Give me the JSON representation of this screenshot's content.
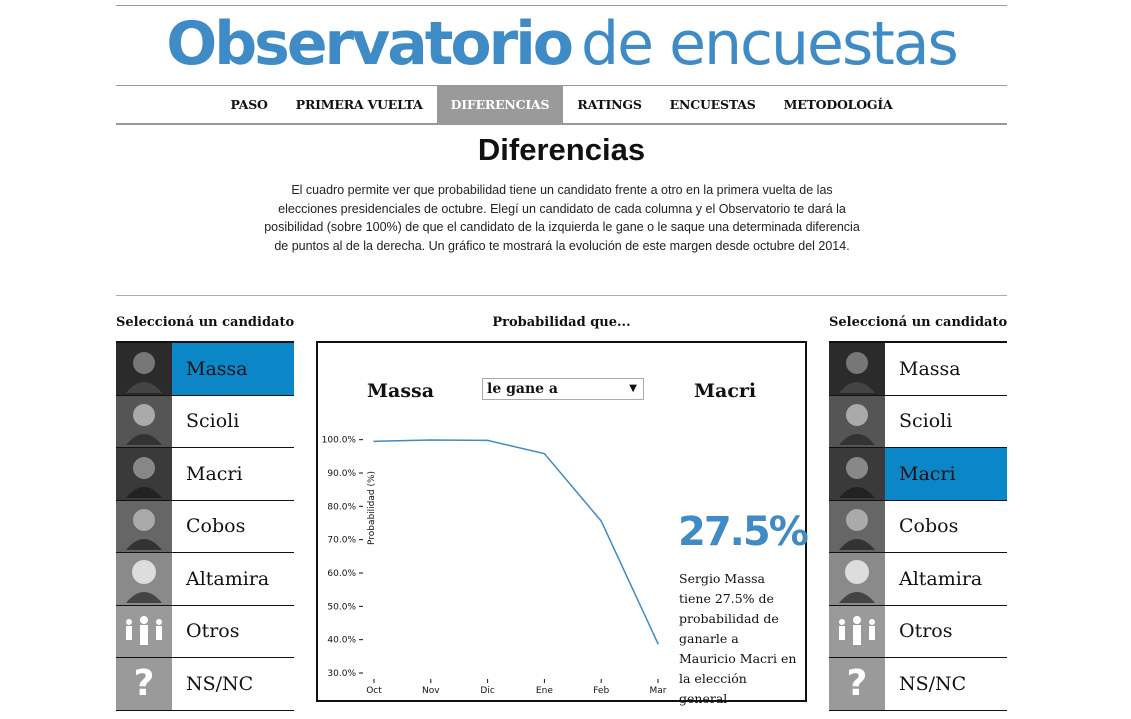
{
  "site": {
    "title_bold": "Observatorio",
    "title_light": "de encuestas"
  },
  "nav": [
    {
      "label": "PASO",
      "active": false
    },
    {
      "label": "PRIMERA VUELTA",
      "active": false
    },
    {
      "label": "DIFERENCIAS",
      "active": true
    },
    {
      "label": "RATINGS",
      "active": false
    },
    {
      "label": "ENCUESTAS",
      "active": false
    },
    {
      "label": "METODOLOGÍA",
      "active": false
    }
  ],
  "page": {
    "title": "Diferencias",
    "intro": "El cuadro permite ver que probabilidad tiene un candidato frente a otro en la primera vuelta de las elecciones presidenciales de octubre. Elegí un candidato de cada columna y el Observatorio te dará la posibilidad (sobre 100%) de que el candidato de la izquierda le gane o le saque una determinada diferencia de puntos al de la derecha. Un gráfico te mostrará la evolución de este margen desde octubre del 2014."
  },
  "left_column": {
    "heading": "Seleccioná un candidato",
    "candidates": [
      {
        "name": "Massa",
        "selected": true,
        "icon": "portrait-photo"
      },
      {
        "name": "Scioli",
        "selected": false,
        "icon": "portrait-photo"
      },
      {
        "name": "Macri",
        "selected": false,
        "icon": "portrait-photo"
      },
      {
        "name": "Cobos",
        "selected": false,
        "icon": "portrait-photo"
      },
      {
        "name": "Altamira",
        "selected": false,
        "icon": "portrait-photo"
      },
      {
        "name": "Otros",
        "selected": false,
        "icon": "people-icon"
      },
      {
        "name": "NS/NC",
        "selected": false,
        "icon": "question-icon"
      }
    ]
  },
  "right_column": {
    "heading": "Seleccioná un candidato",
    "candidates": [
      {
        "name": "Massa",
        "selected": false,
        "icon": "portrait-photo"
      },
      {
        "name": "Scioli",
        "selected": false,
        "icon": "portrait-photo"
      },
      {
        "name": "Macri",
        "selected": true,
        "icon": "portrait-photo"
      },
      {
        "name": "Cobos",
        "selected": false,
        "icon": "portrait-photo"
      },
      {
        "name": "Altamira",
        "selected": false,
        "icon": "portrait-photo"
      },
      {
        "name": "Otros",
        "selected": false,
        "icon": "people-icon"
      },
      {
        "name": "NS/NC",
        "selected": false,
        "icon": "question-icon"
      }
    ]
  },
  "center": {
    "heading": "Probabilidad que...",
    "left_name": "Massa",
    "right_name": "Macri",
    "select_value": "le gane a",
    "big_percent": "27.5%",
    "summary": "Sergio Massa tiene 27.5% de probabilidad de ganarle a Mauricio Macri en la elección general"
  },
  "colors": {
    "accent": "#3f8bc6",
    "selected_row": "#0b87c8",
    "nav_active": "#9a9a9a"
  },
  "chart_data": {
    "type": "line",
    "title": "",
    "xlabel": "",
    "ylabel": "Probabilidad (%)",
    "categories": [
      "Oct",
      "Nov",
      "Dic",
      "Ene",
      "Feb",
      "Mar"
    ],
    "x": [
      0,
      1,
      2,
      3,
      4,
      5
    ],
    "values": [
      99.5,
      99.9,
      99.8,
      95.8,
      75.6,
      38.8
    ],
    "ylim": [
      27,
      102
    ],
    "yticks": [
      100,
      90,
      80,
      70,
      60,
      50,
      40,
      30
    ],
    "ytick_labels": [
      "100.0%",
      "90.0%",
      "80.0%",
      "70.0%",
      "60.0%",
      "50.0%",
      "40.0%",
      "30.0%"
    ],
    "grid": false,
    "line_color": "#3f8bc6"
  }
}
